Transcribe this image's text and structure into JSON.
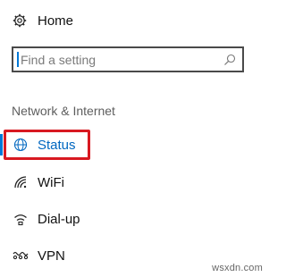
{
  "home": {
    "label": "Home",
    "icon": "gear-icon"
  },
  "search": {
    "placeholder": "Find a setting",
    "value": "",
    "icon": "search-icon"
  },
  "section": {
    "heading": "Network & Internet"
  },
  "nav": {
    "items": [
      {
        "label": "Status",
        "icon": "globe-icon",
        "selected": true
      },
      {
        "label": "WiFi",
        "icon": "wifi-icon",
        "selected": false
      },
      {
        "label": "Dial-up",
        "icon": "dialup-icon",
        "selected": false
      },
      {
        "label": "VPN",
        "icon": "vpn-icon",
        "selected": false
      }
    ]
  },
  "watermark": {
    "text": "wsxdn.com"
  },
  "colors": {
    "accent": "#0078d7",
    "highlight": "#d81921"
  }
}
